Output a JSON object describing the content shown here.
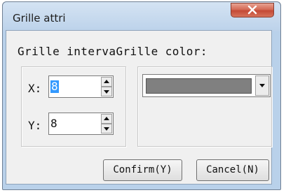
{
  "window": {
    "title": "Grille attri",
    "close_icon": "close-x-icon"
  },
  "header": {
    "interval_label": "Grille interva",
    "color_label": "Grille color:"
  },
  "fields": {
    "x_label": "X:",
    "x_value": "8",
    "y_label": "Y:",
    "y_value": "8"
  },
  "color": {
    "selected_hex": "#808080"
  },
  "buttons": {
    "confirm_label": "Confirm(Y)",
    "cancel_label": "Cancel(N)"
  }
}
